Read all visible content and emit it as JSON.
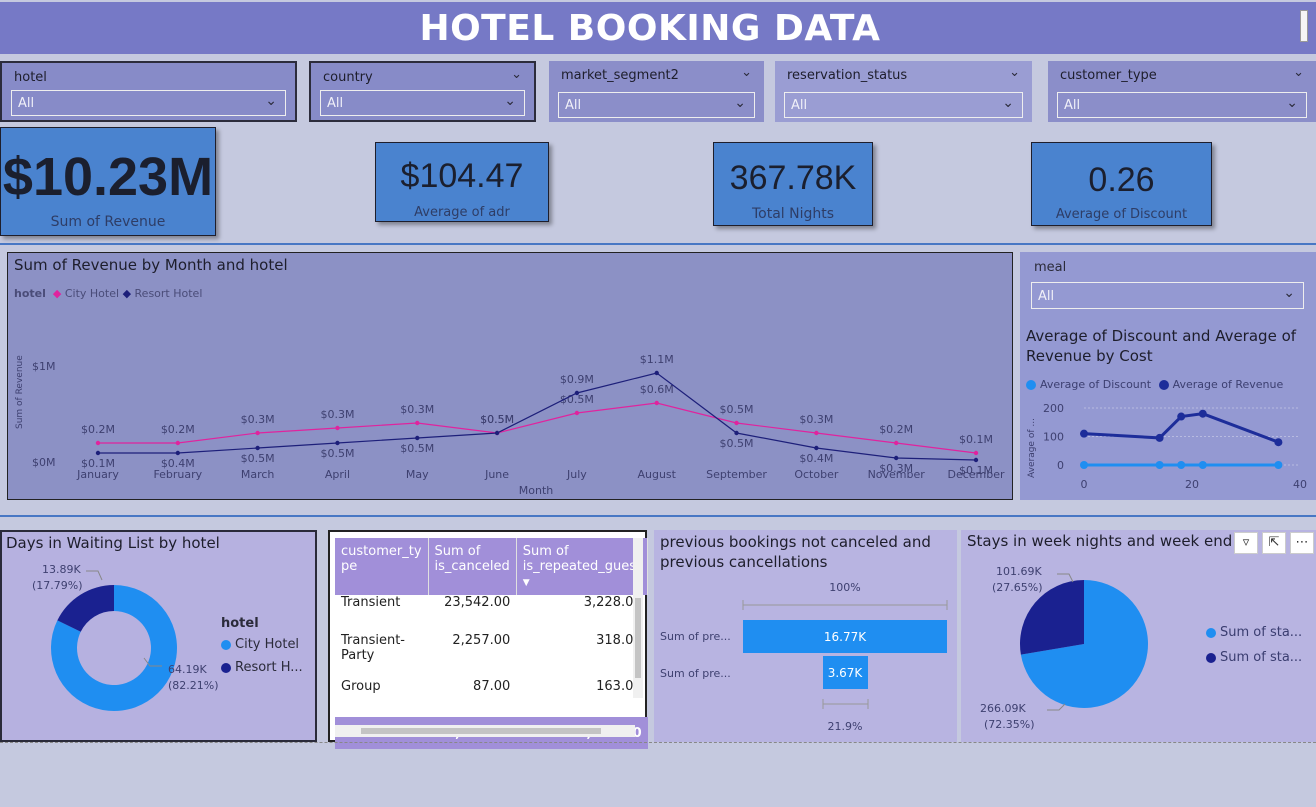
{
  "header": {
    "title": "HOTEL BOOKING DATA"
  },
  "slicers": [
    {
      "label": "hotel",
      "value": "All"
    },
    {
      "label": "country",
      "value": "All"
    },
    {
      "label": "market_segment2",
      "value": "All"
    },
    {
      "label": "reservation_status",
      "value": "All"
    },
    {
      "label": "customer_type",
      "value": "All"
    }
  ],
  "kpis": [
    {
      "value": "$10.23M",
      "label": "Sum of Revenue"
    },
    {
      "value": "$104.47",
      "label": "Average of adr"
    },
    {
      "value": "367.78K",
      "label": "Total Nights"
    },
    {
      "value": "0.26",
      "label": "Average of Discount"
    }
  ],
  "line_chart": {
    "title": "Sum of Revenue by Month and hotel",
    "legend_title": "hotel",
    "xlabel": "Month",
    "ylabel": "Sum of Revenue",
    "y_ticks": [
      "$1M",
      "$0M"
    ]
  },
  "chart_data": [
    {
      "type": "line",
      "title": "Sum of Revenue by Month and hotel",
      "xlabel": "Month",
      "ylabel": "Sum of Revenue",
      "categories": [
        "January",
        "February",
        "March",
        "April",
        "May",
        "June",
        "July",
        "August",
        "September",
        "October",
        "November",
        "December"
      ],
      "series": [
        {
          "name": "City Hotel",
          "color": "#e0239e",
          "values": [
            0.2,
            0.2,
            0.3,
            0.35,
            0.4,
            0.3,
            0.5,
            0.6,
            0.4,
            0.3,
            0.2,
            0.1
          ],
          "labels": [
            "$0.2M",
            "$0.2M",
            "$0.3M",
            "$0.3M",
            "$0.3M",
            "$0.5M",
            "$0.5M",
            "$0.6M",
            "$0.5M",
            "$0.3M",
            "$0.2M",
            "$0.1M"
          ]
        },
        {
          "name": "Resort Hotel",
          "color": "#1d1f7a",
          "values": [
            0.1,
            0.1,
            0.15,
            0.2,
            0.25,
            0.3,
            0.7,
            0.9,
            0.3,
            0.15,
            0.05,
            0.03
          ],
          "labels": [
            "$0.1M",
            "$0.4M",
            "$0.5M",
            "$0.5M",
            "$0.5M",
            "$0.5M",
            "$0.9M",
            "$1.1M",
            "$0.5M",
            "$0.4M",
            "$0.3M",
            "$0.1M"
          ]
        }
      ],
      "ylim": [
        0,
        1.2
      ]
    },
    {
      "type": "line",
      "title": "Average of Discount and Average of Revenue by Cost",
      "ylabel": "Average of ...",
      "x_ticks": [
        "0",
        "20",
        "40"
      ],
      "y_ticks": [
        "200",
        "100",
        "0"
      ],
      "series": [
        {
          "name": "Average of Discount",
          "color": "#1f8ef1",
          "x": [
            0,
            14,
            18,
            22,
            36
          ],
          "values": [
            0,
            0,
            0,
            0,
            0
          ]
        },
        {
          "name": "Average of Revenue",
          "color": "#1d2d9a",
          "x": [
            0,
            14,
            18,
            22,
            36
          ],
          "values": [
            110,
            95,
            170,
            180,
            80
          ]
        }
      ],
      "xlim": [
        0,
        40
      ],
      "ylim": [
        0,
        200
      ]
    },
    {
      "type": "pie",
      "title": "Days in Waiting List by hotel",
      "legend_title": "hotel",
      "categories": [
        "City Hotel",
        "Resort H..."
      ],
      "values": [
        64190,
        13890
      ],
      "labels": [
        "64.19K",
        "13.89K"
      ],
      "percents": [
        "(82.21%)",
        "(17.79%)"
      ],
      "colors": [
        "#1f8ef1",
        "#1a2190"
      ]
    },
    {
      "type": "bar",
      "title": "previous bookings not canceled and previous cancellations",
      "categories": [
        "Sum of pre...",
        "Sum of pre..."
      ],
      "values": [
        16770,
        3670
      ],
      "labels": [
        "16.77K",
        "3.67K"
      ],
      "top_label": "100%",
      "bottom_label": "21.9%"
    },
    {
      "type": "pie",
      "title": "Stays in week nights and week end",
      "categories": [
        "Sum of sta...",
        "Sum of sta..."
      ],
      "values": [
        266090,
        101690
      ],
      "labels": [
        "266.09K",
        "101.69K"
      ],
      "percents": [
        "(72.35%)",
        "(27.65%)"
      ],
      "colors": [
        "#1f8ef1",
        "#1a2190"
      ]
    }
  ],
  "meal_slicer": {
    "label": "meal",
    "value": "All"
  },
  "scatter": {
    "title": "Average of Discount and Average of Revenue by Cost",
    "legend": [
      "Average of Discount",
      "Average of Revenue"
    ],
    "ylabel": "Average of ..."
  },
  "donut": {
    "title": "Days in Waiting List by hotel",
    "legend_title": "hotel",
    "legend": [
      "City Hotel",
      "Resort H..."
    ],
    "big_value": "64.19K",
    "big_pct": "(82.21%)",
    "small_value": "13.89K",
    "small_pct": "(17.79%)"
  },
  "table": {
    "headers": [
      "customer_ty pe",
      "Sum of is_canceled",
      "Sum of is_repeated_guest"
    ],
    "rows": [
      [
        "Transient",
        "23,542.00",
        "3,228.00"
      ],
      [
        "Transient-Party",
        "2,257.00",
        "318.00"
      ],
      [
        "Group",
        "87.00",
        "163.00"
      ]
    ],
    "total": [
      "Total",
      "26,707.00",
      "3,758.00"
    ]
  },
  "bars": {
    "title": "previous bookings not canceled and previous cancellations",
    "top_pct": "100%",
    "bottom_pct": "21.9%",
    "row1_label": "Sum of pre...",
    "row1_value": "16.77K",
    "row2_label": "Sum of pre...",
    "row2_value": "3.67K"
  },
  "pie": {
    "title": "Stays in week nights and week end",
    "legend": [
      "Sum of sta...",
      "Sum of sta..."
    ],
    "small_value": "101.69K",
    "small_pct": "(27.65%)",
    "big_value": "266.09K",
    "big_pct": "(72.35%)"
  }
}
